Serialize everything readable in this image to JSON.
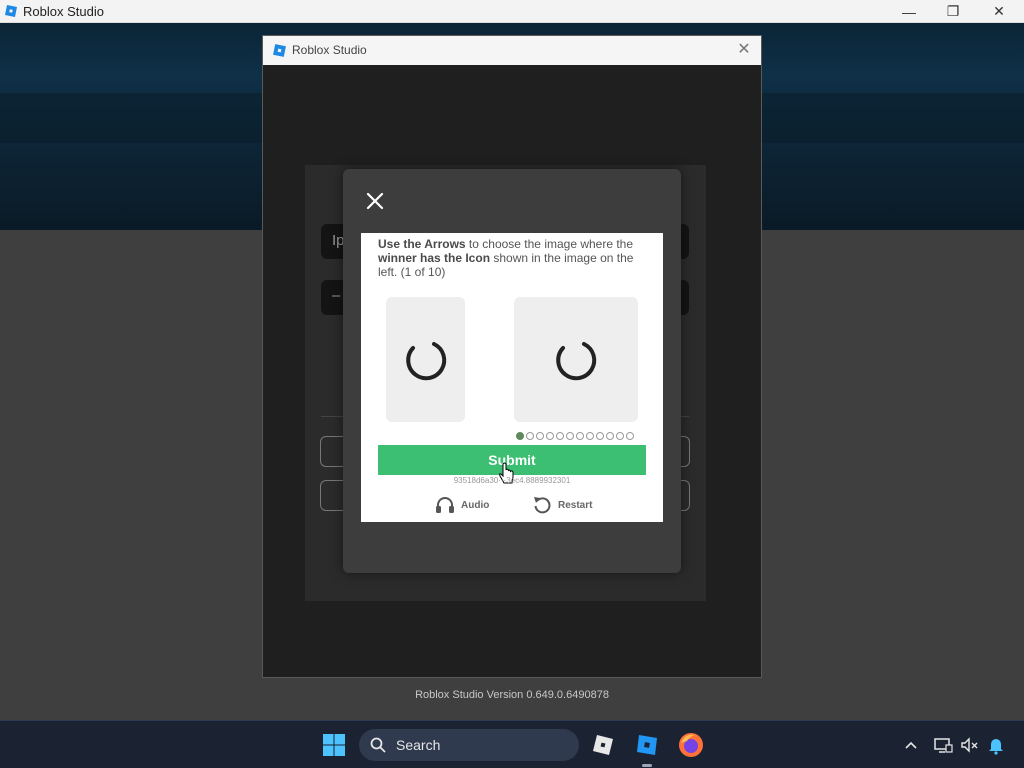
{
  "app_window": {
    "title": "Roblox Studio",
    "controls": {
      "minimize": "—",
      "maximize": "❐",
      "close": "✕"
    }
  },
  "dialog": {
    "title": "Roblox Studio",
    "close_glyph": "✕",
    "version_text": "Roblox Studio Version 0.649.0.6490878",
    "login_panel": {
      "field1_partial": "Ip",
      "field2_partial": "–"
    }
  },
  "captcha": {
    "instruction_bold1": "Use the Arrows",
    "instruction_text1": " to choose the image where the ",
    "instruction_bold2": "winner has the Icon",
    "instruction_text2": " shown in the image on the left. (1 of 10)",
    "progress": {
      "current": 1,
      "total": 10,
      "dot_count": 12
    },
    "submit_label": "Submit",
    "session_id": "93518d6a30···3ec4.8889932301",
    "audio_label": "Audio",
    "restart_label": "Restart"
  },
  "taskbar": {
    "search_label": "Search",
    "apps": [
      "roblox-player-icon",
      "roblox-studio-icon",
      "firefox-icon"
    ],
    "tray": [
      "chevron-up-icon",
      "display-icon",
      "mute-icon",
      "bell-icon"
    ]
  },
  "colors": {
    "submit_green": "#3dbf73",
    "active_dot": "#5e8a5e",
    "taskbar": "#1b2333"
  }
}
